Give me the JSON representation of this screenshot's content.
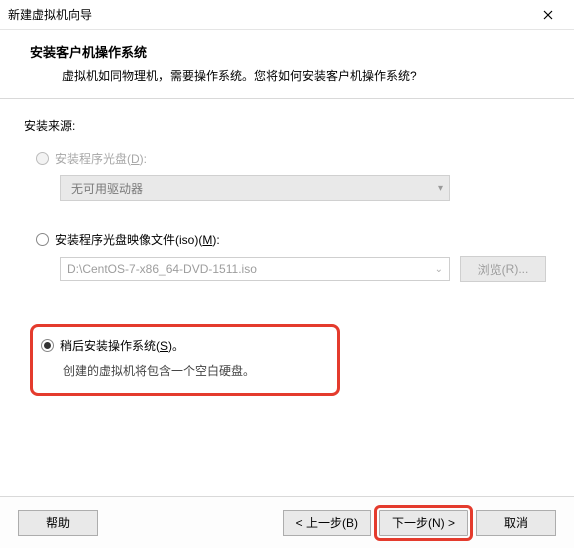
{
  "window": {
    "title": "新建虚拟机向导"
  },
  "header": {
    "heading": "安装客户机操作系统",
    "sub": "虚拟机如同物理机，需要操作系统。您将如何安装客户机操作系统?"
  },
  "source": {
    "label": "安装来源:",
    "opt_disc": {
      "label_pre": "安装程序光盘(",
      "hot": "D",
      "label_post": "):"
    },
    "drive_combo": "无可用驱动器",
    "opt_iso": {
      "label_pre": "安装程序光盘映像文件(iso)(",
      "hot": "M",
      "label_post": "):"
    },
    "iso_path": "D:\\CentOS-7-x86_64-DVD-1511.iso",
    "browse": {
      "pre": "浏览(",
      "hot": "R",
      "post": ")..."
    },
    "opt_later": {
      "label_pre": "稍后安装操作系统(",
      "hot": "S",
      "label_post": ")。"
    },
    "later_hint": "创建的虚拟机将包含一个空白硬盘。"
  },
  "footer": {
    "help": "帮助",
    "back": {
      "pre": "< 上一步(",
      "hot": "B",
      "post": ")"
    },
    "next": {
      "pre": "下一步(",
      "hot": "N",
      "post": ") >"
    },
    "cancel": "取消"
  }
}
